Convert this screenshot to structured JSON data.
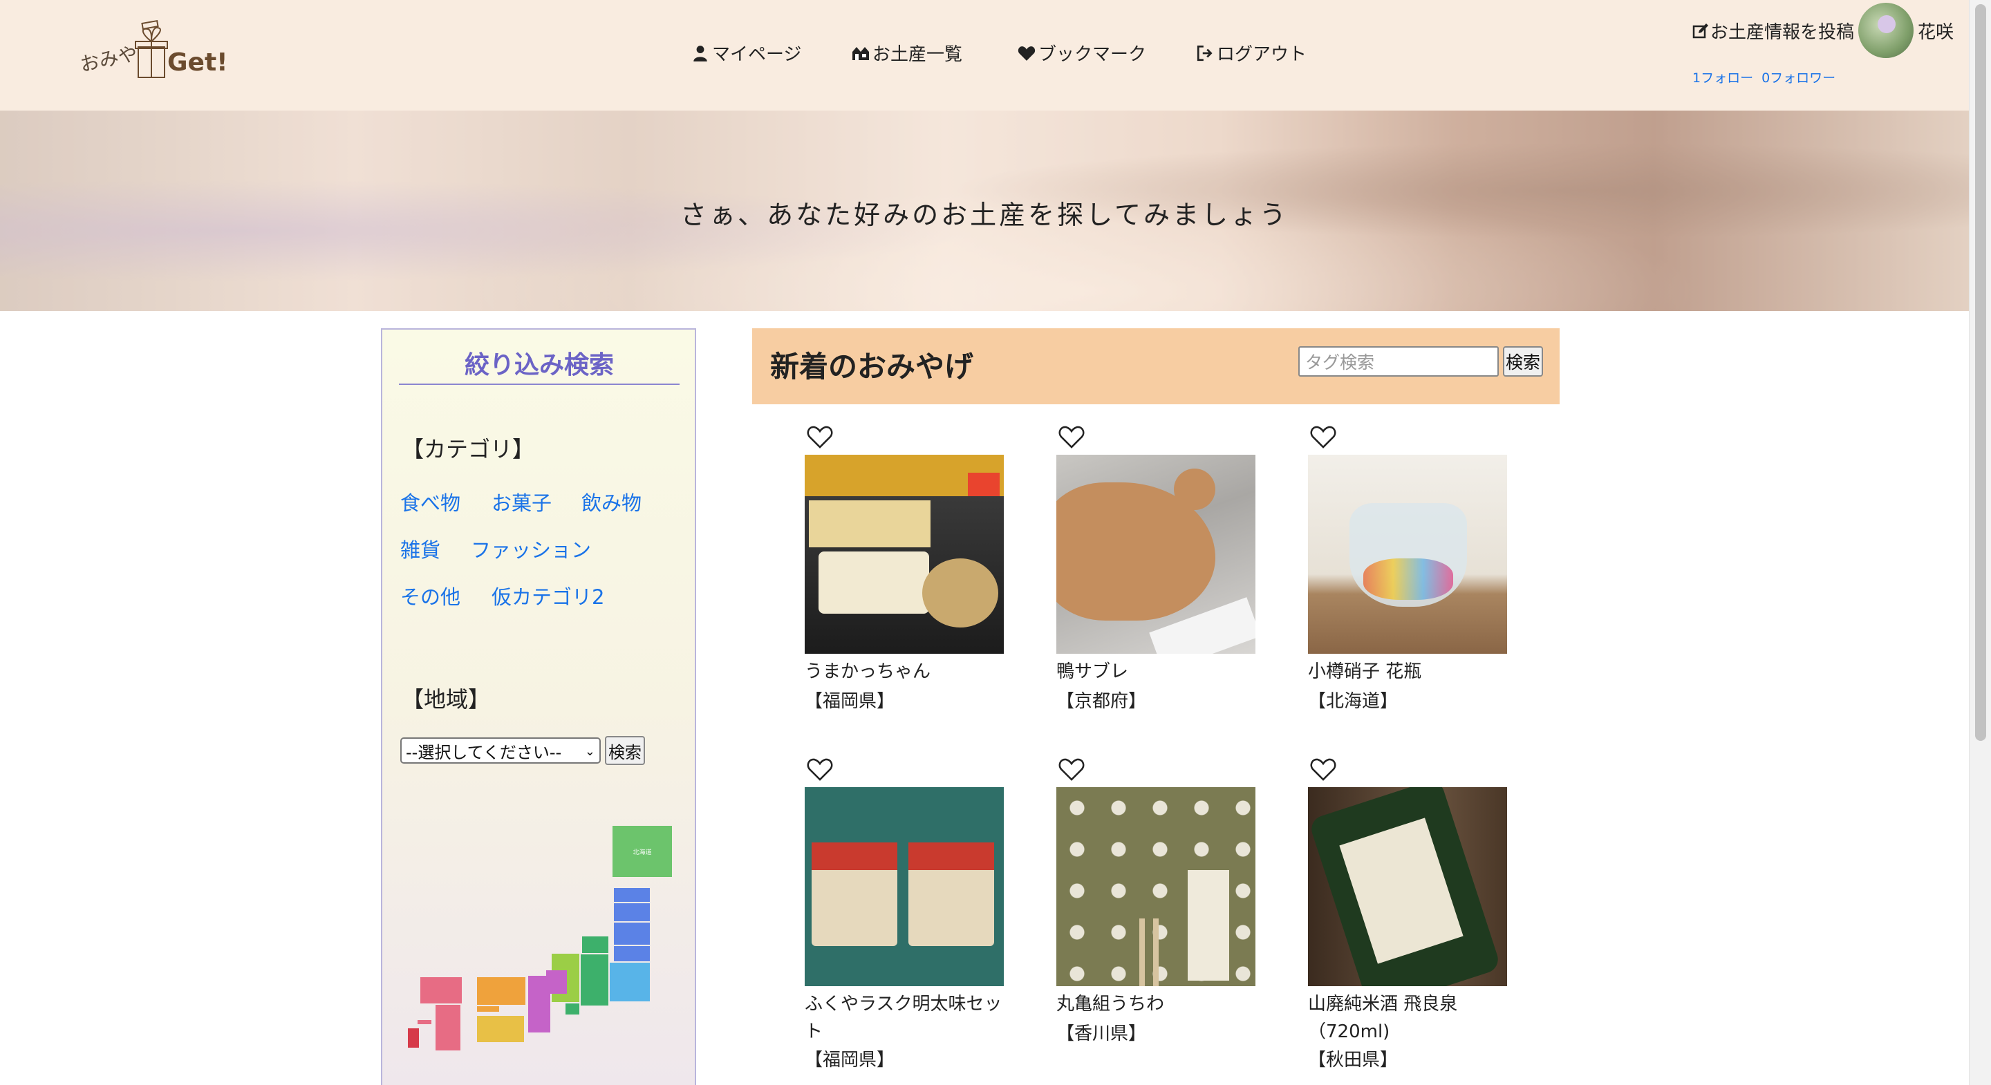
{
  "header": {
    "logo_text_1": "おみや",
    "logo_text_2": "Get!",
    "nav": {
      "mypage": "マイページ",
      "souvenir_list": "お土産一覧",
      "bookmark": "ブックマーク",
      "logout": "ログアウト"
    },
    "post_label": "お土産情報を投稿",
    "username": "花咲",
    "following": "1フォロー",
    "followers": "0フォロワー"
  },
  "hero": {
    "text": "さぁ、あなた好みのお土産を探してみましょう"
  },
  "sidebar": {
    "title": "絞り込み検索",
    "category_heading": "【カテゴリ】",
    "categories": [
      "食べ物",
      "お菓子",
      "飲み物",
      "雑貨",
      "ファッション",
      "その他",
      "仮カテゴリ2"
    ],
    "region_heading": "【地域】",
    "region_select_value": "--選択してください--",
    "region_search_label": "検索",
    "map_label_hokkaido": "北海道"
  },
  "main": {
    "title": "新着のおみやげ",
    "tag_placeholder": "タグ検索",
    "tag_search_label": "検索",
    "items": [
      {
        "name": "うまかっちゃん",
        "pref": "【福岡県】"
      },
      {
        "name": "鴨サブレ",
        "pref": "【京都府】"
      },
      {
        "name": "小樽硝子 花瓶",
        "pref": "【北海道】"
      },
      {
        "name": "ふくやラスク明太味セット",
        "pref": "【福岡県】"
      },
      {
        "name": "丸亀組うちわ",
        "pref": "【香川県】"
      },
      {
        "name": "山廃純米酒 飛良泉（720ml)",
        "pref": "【秋田県】"
      }
    ]
  },
  "colors": {
    "header_bg": "#f9ece0",
    "accent_purple": "#6b63c6",
    "link_blue": "#1a73e8",
    "main_header_bg": "#f7cda2"
  }
}
